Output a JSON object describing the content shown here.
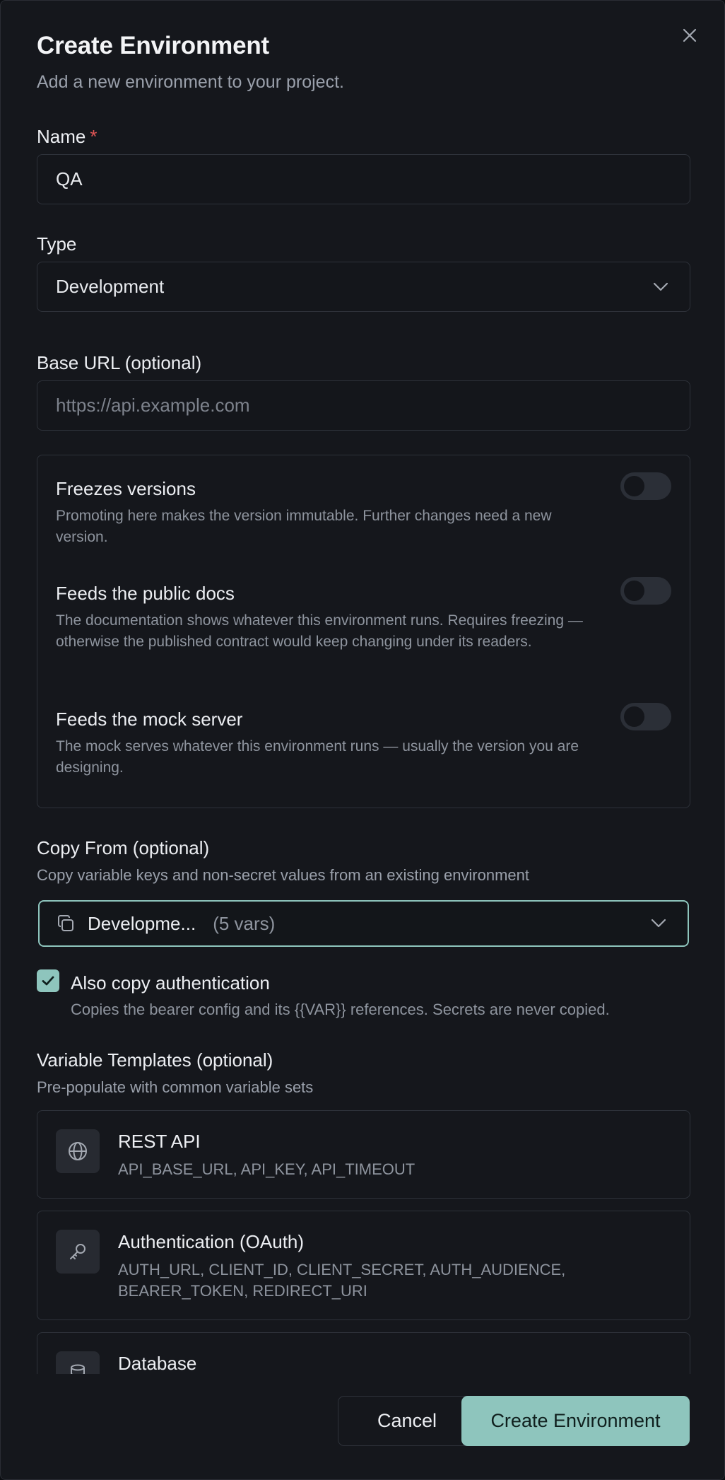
{
  "dialog": {
    "title": "Create Environment",
    "subtitle": "Add a new environment to your project."
  },
  "name_field": {
    "label": "Name",
    "required_mark": "*",
    "value": "QA"
  },
  "type_field": {
    "label": "Type",
    "value": "Development"
  },
  "base_url_field": {
    "label": "Base URL (optional)",
    "placeholder": "https://api.example.com"
  },
  "toggles": [
    {
      "title": "Freezes versions",
      "description": "Promoting here makes the version immutable. Further changes need a new version.",
      "enabled": false
    },
    {
      "title": "Feeds the public docs",
      "description": "The documentation shows whatever this environment runs. Requires freezing — otherwise the published contract would keep changing under its readers.",
      "enabled": false
    },
    {
      "title": "Feeds the mock server",
      "description": "The mock serves whatever this environment runs — usually the version you are designing.",
      "enabled": false
    }
  ],
  "copy_from": {
    "label": "Copy From (optional)",
    "hint": "Copy variable keys and non-secret values from an existing environment",
    "selected": "Developme...",
    "selected_meta": "(5 vars)",
    "icon": "copy-icon"
  },
  "copy_auth": {
    "checked": true,
    "label": "Also copy authentication",
    "description": "Copies the bearer config and its {{VAR}} references. Secrets are never copied."
  },
  "templates": {
    "label": "Variable Templates (optional)",
    "hint": "Pre-populate with common variable sets",
    "items": [
      {
        "name": "REST API",
        "vars": "API_BASE_URL, API_KEY, API_TIMEOUT",
        "icon": "globe-icon"
      },
      {
        "name": "Authentication (OAuth)",
        "vars": "AUTH_URL, CLIENT_ID, CLIENT_SECRET, AUTH_AUDIENCE, BEARER_TOKEN, REDIRECT_URI",
        "icon": "key-icon"
      },
      {
        "name": "Database",
        "vars": "",
        "icon": "database-icon"
      }
    ]
  },
  "footer": {
    "cancel_label": "Cancel",
    "create_label": "Create Environment"
  },
  "colors": {
    "accent": "#8ec5bd",
    "background": "#15171c",
    "border": "#2e323a",
    "required": "#e05555"
  }
}
